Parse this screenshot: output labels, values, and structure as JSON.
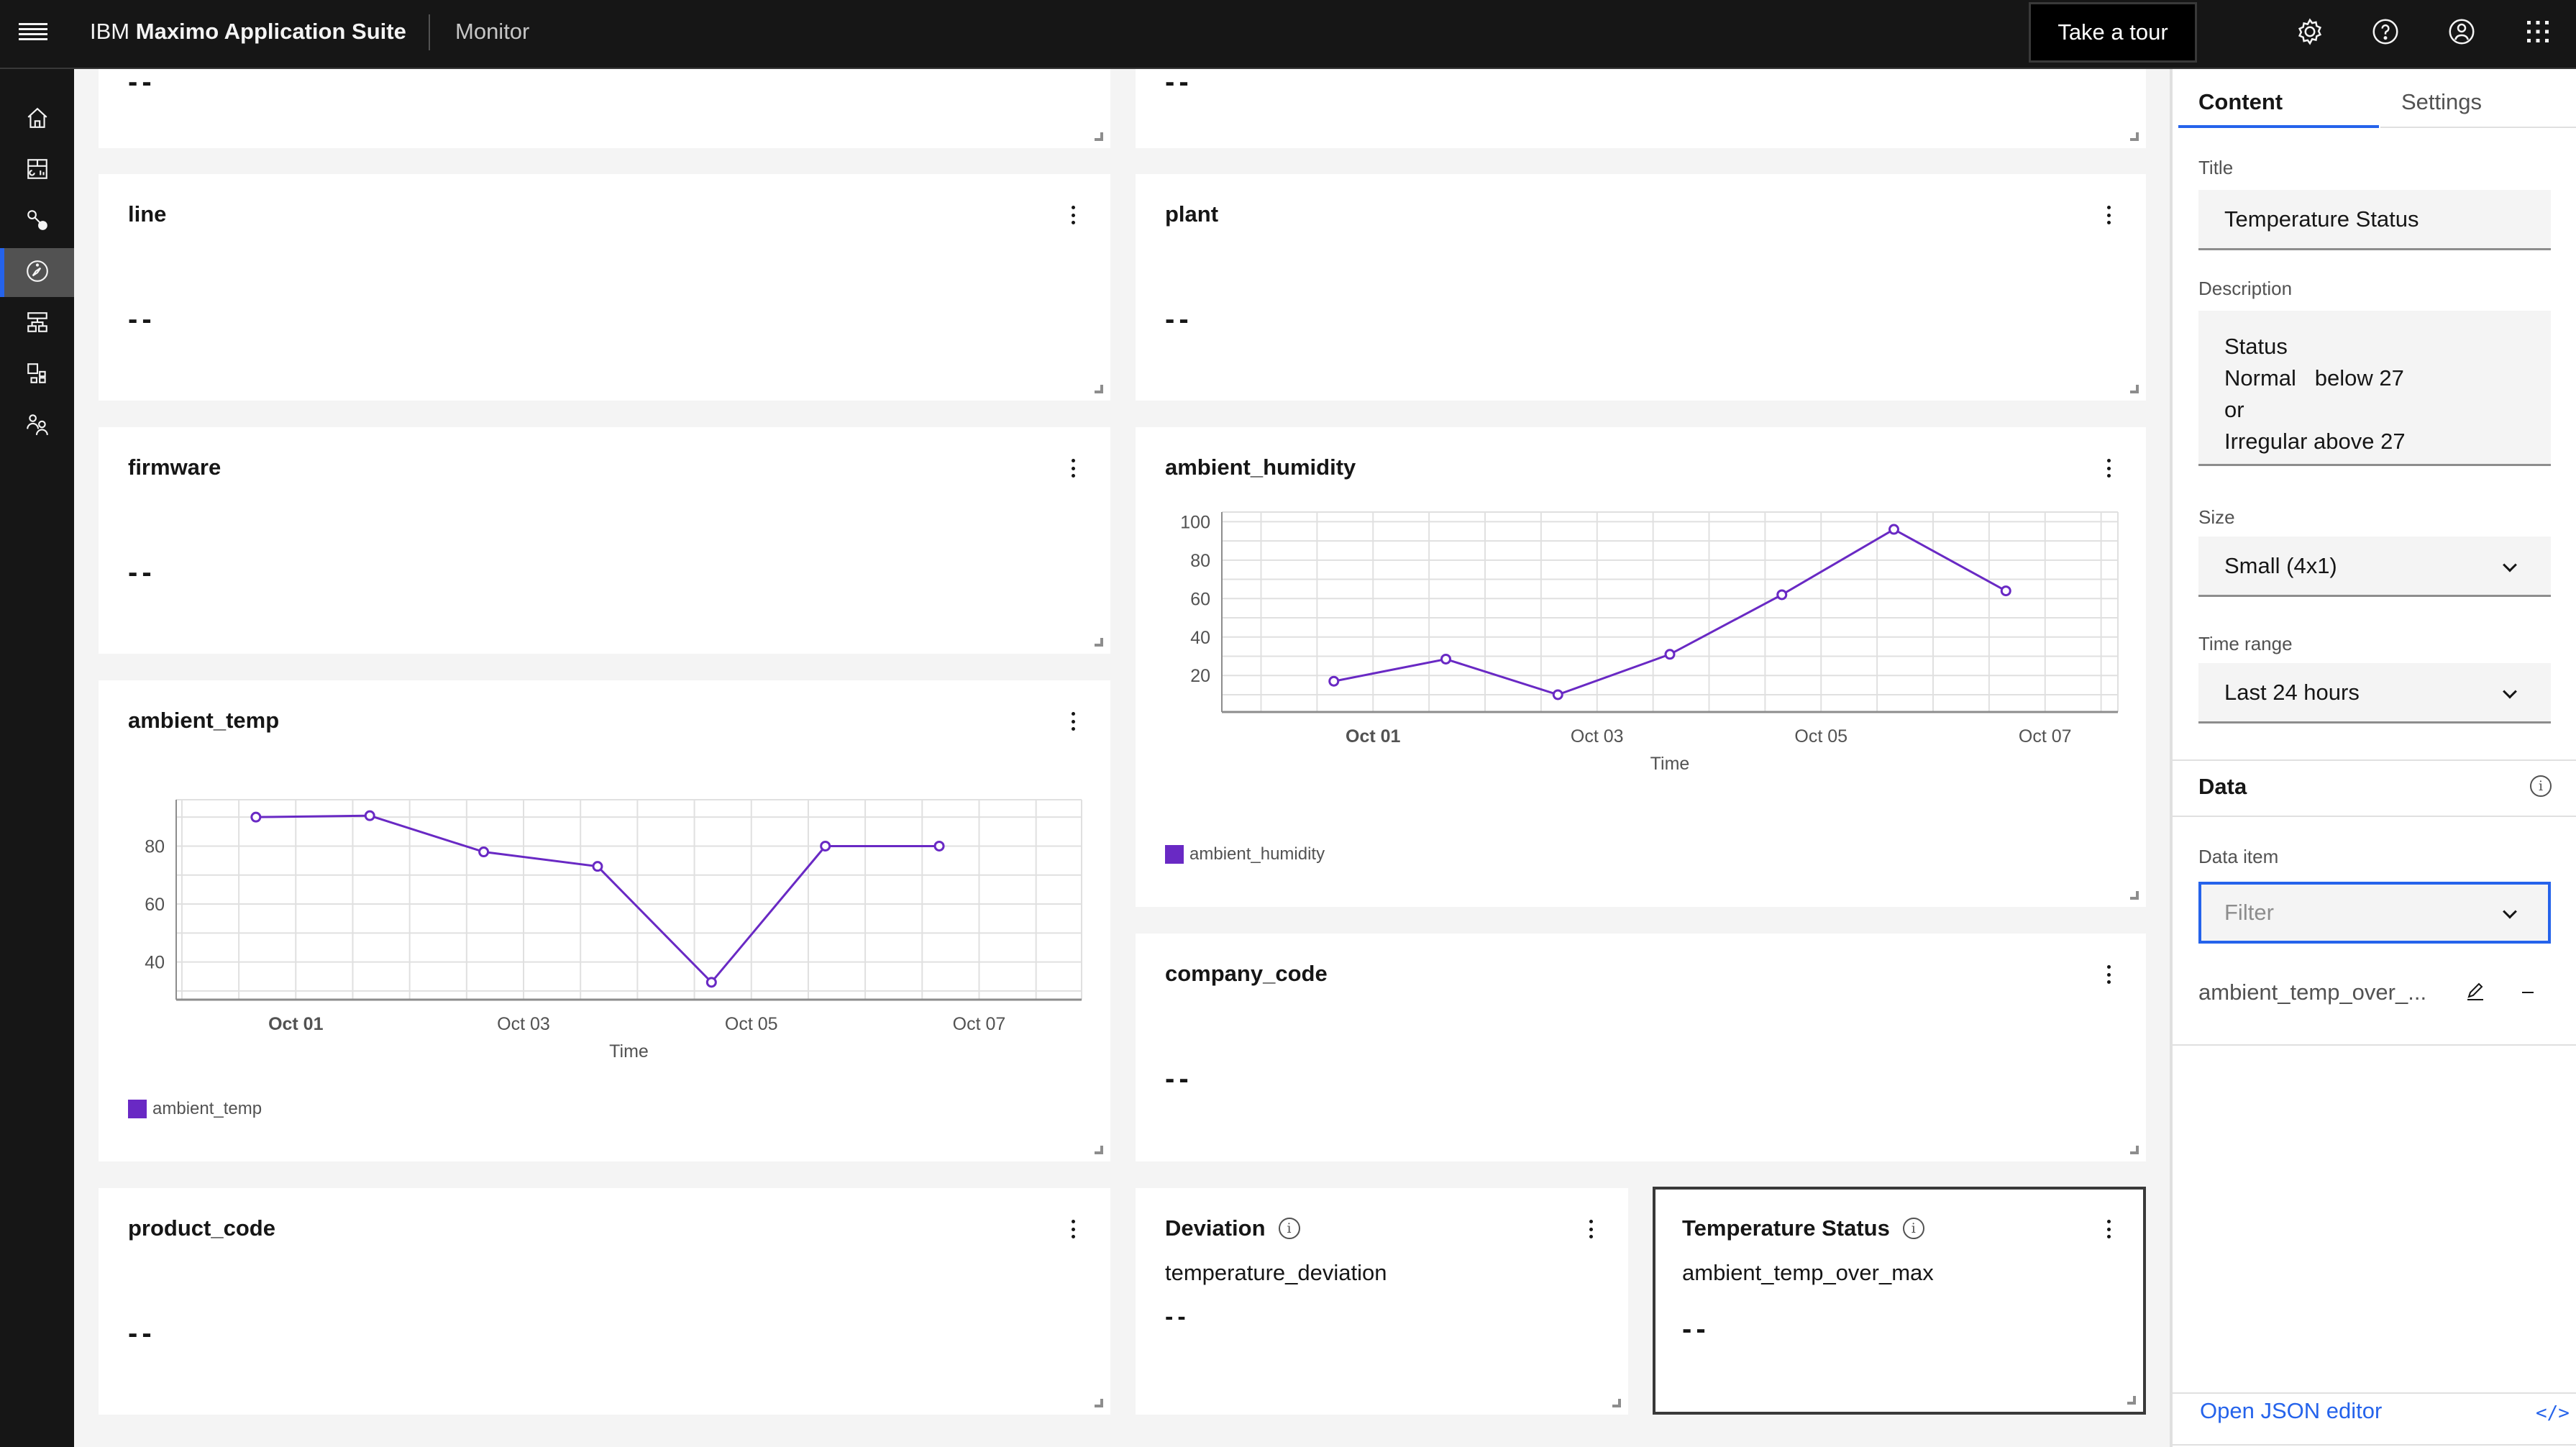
{
  "header": {
    "brand_prefix": "IBM",
    "brand_name": "Maximo Application Suite",
    "product": "Monitor",
    "tour_button": "Take a tour",
    "icons": [
      "settings-icon",
      "help-icon",
      "user-avatar-icon",
      "app-switcher-icon"
    ]
  },
  "sidebar": {
    "items": [
      {
        "name": "home",
        "active": false
      },
      {
        "name": "dashboards",
        "active": false
      },
      {
        "name": "connections",
        "active": false
      },
      {
        "name": "monitor",
        "active": true
      },
      {
        "name": "hierarchy",
        "active": false
      },
      {
        "name": "devices",
        "active": false
      },
      {
        "name": "users",
        "active": false
      }
    ]
  },
  "cards": {
    "top_left": {
      "value": "--"
    },
    "top_right": {
      "value": "--"
    },
    "line": {
      "title": "line",
      "value": "--"
    },
    "plant": {
      "title": "plant",
      "value": "--"
    },
    "firmware": {
      "title": "firmware",
      "value": "--"
    },
    "ambient_temp": {
      "title": "ambient_temp"
    },
    "ambient_humidity": {
      "title": "ambient_humidity"
    },
    "company_code": {
      "title": "company_code",
      "value": "--"
    },
    "product_code": {
      "title": "product_code",
      "value": "--"
    },
    "deviation": {
      "title": "Deviation",
      "subtitle": "temperature_deviation",
      "value": "--"
    },
    "temperature_status": {
      "title": "Temperature Status",
      "subtitle": "ambient_temp_over_max",
      "value": "--"
    }
  },
  "chart_data": [
    {
      "type": "line",
      "title": "ambient_temp",
      "xlabel": "Time",
      "ylabel": "",
      "x": [
        "Sep 30 12:00",
        "Oct 01 12:00",
        "Oct 02 12:00",
        "Oct 03 12:00",
        "Oct 04 12:00",
        "Oct 05 12:00",
        "Oct 06 12:00"
      ],
      "x_positions": [
        -0.35,
        0.65,
        1.65,
        2.65,
        3.65,
        4.65,
        5.65
      ],
      "x_ticks": [
        "Oct 01",
        "Oct 03",
        "Oct 05",
        "Oct 07"
      ],
      "x_tick_positions": [
        0,
        2,
        4,
        6
      ],
      "x_range": [
        -1.05,
        6.9
      ],
      "y_ticks": [
        40,
        60,
        80
      ],
      "ylim": [
        27,
        96
      ],
      "grid": true,
      "series": [
        {
          "name": "ambient_temp",
          "color": "#6929c4",
          "values": [
            90,
            90.5,
            78,
            73,
            33,
            80,
            80
          ]
        }
      ],
      "legend": "bottom-left"
    },
    {
      "type": "line",
      "title": "ambient_humidity",
      "xlabel": "Time",
      "ylabel": "",
      "x": [
        "Sep 30 12:00",
        "Oct 01 12:00",
        "Oct 02 12:00",
        "Oct 03 12:00",
        "Oct 04 12:00",
        "Oct 05 12:00",
        "Oct 06 12:00"
      ],
      "x_positions": [
        -0.35,
        0.65,
        1.65,
        2.65,
        3.65,
        4.65,
        5.65
      ],
      "x_ticks": [
        "Oct 01",
        "Oct 03",
        "Oct 05",
        "Oct 07"
      ],
      "x_tick_positions": [
        0,
        2,
        4,
        6
      ],
      "x_range": [
        -1.35,
        6.65
      ],
      "y_ticks": [
        20,
        40,
        60,
        80,
        100
      ],
      "ylim": [
        1,
        105
      ],
      "grid": true,
      "series": [
        {
          "name": "ambient_humidity",
          "color": "#6929c4",
          "values": [
            17,
            28.5,
            10,
            31,
            62,
            96,
            64
          ]
        }
      ],
      "legend": "bottom-left"
    }
  ],
  "panel": {
    "tabs": [
      {
        "label": "Content",
        "active": true
      },
      {
        "label": "Settings",
        "active": false
      }
    ],
    "title_label": "Title",
    "title_value": "Temperature Status",
    "description_label": "Description",
    "description_value": "Status\nNormal   below 27\nor\nIrregular above 27",
    "size_label": "Size",
    "size_value": "Small (4x1)",
    "time_range_label": "Time range",
    "time_range_value": "Last 24 hours",
    "data_section": "Data",
    "data_item_label": "Data item",
    "data_item_placeholder": "Filter",
    "data_items": [
      {
        "name": "ambient_temp_over_..."
      }
    ],
    "json_editor_link": "Open JSON editor",
    "accent_color": "#2563eb"
  }
}
